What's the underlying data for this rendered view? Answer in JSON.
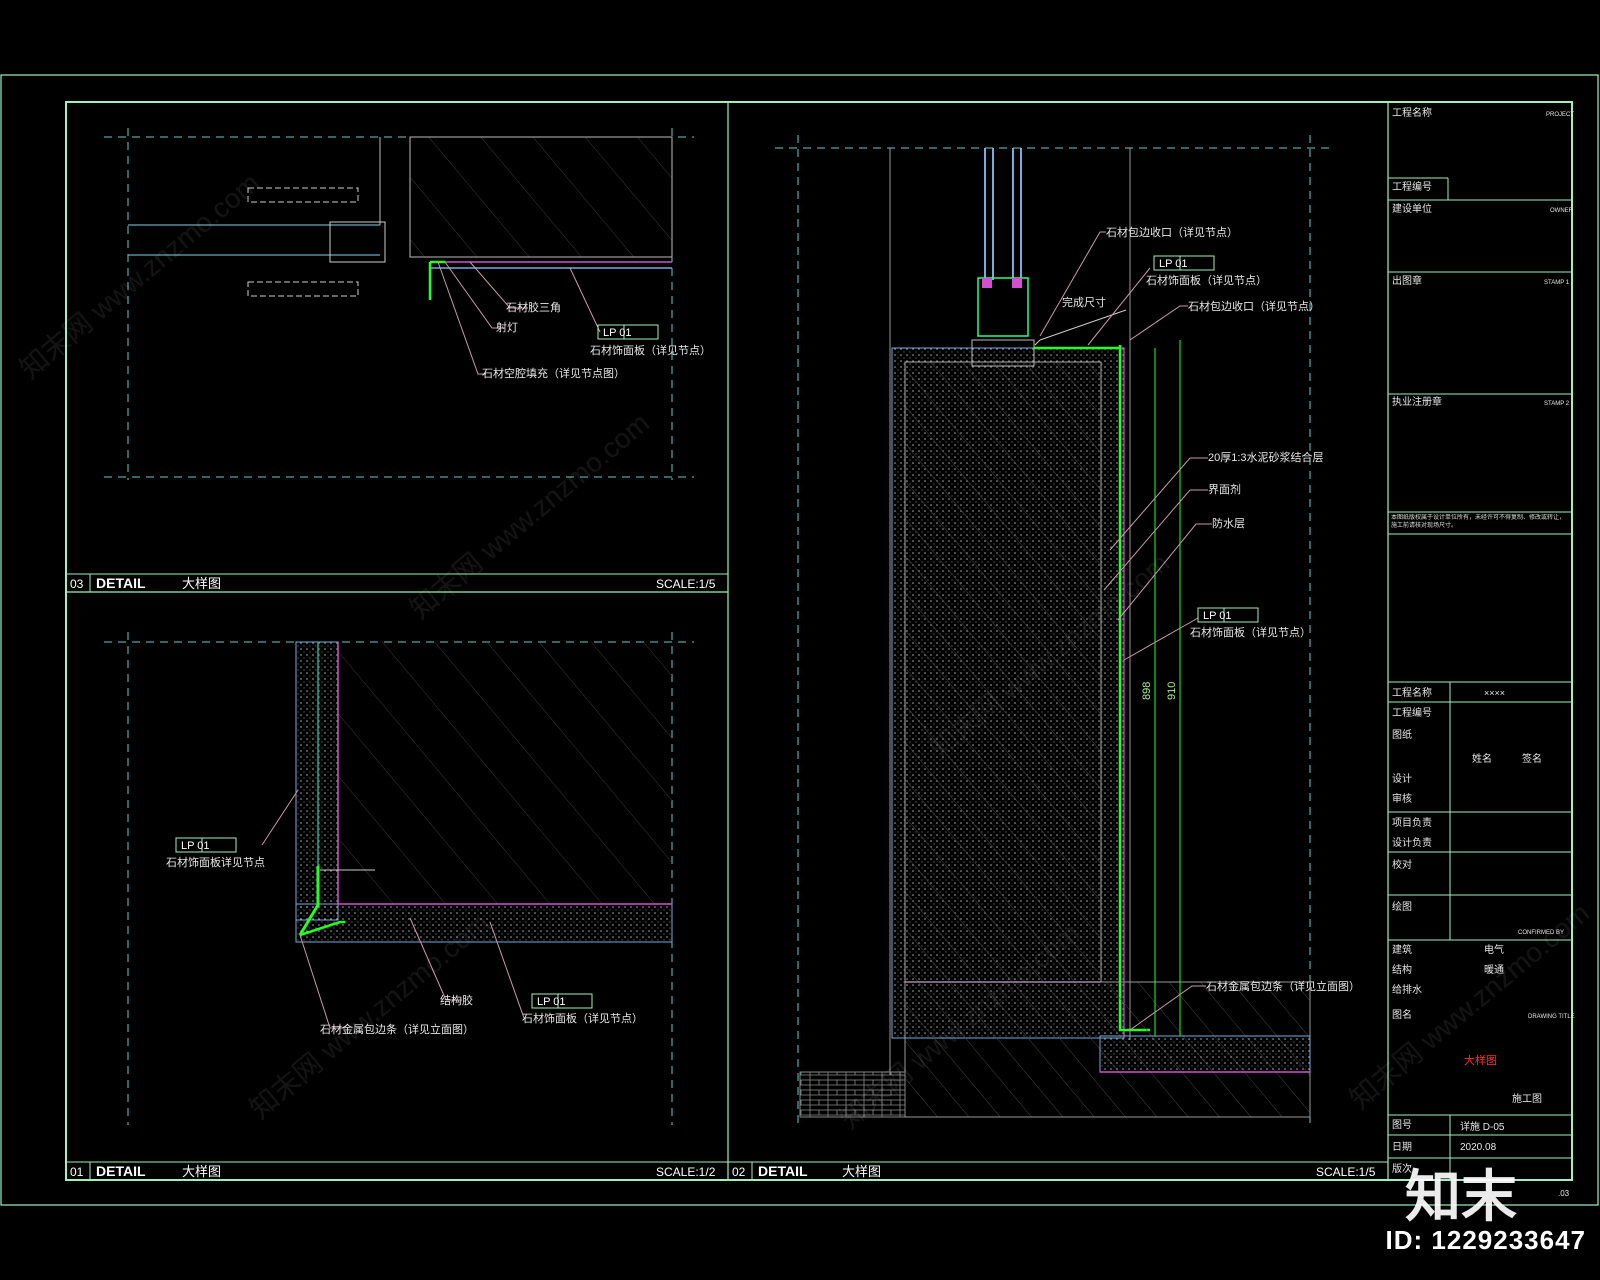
{
  "panels": {
    "p03": {
      "num": "03",
      "title": "DETAIL",
      "subtitle": "大样图",
      "scale": "SCALE:1/5"
    },
    "p01": {
      "num": "01",
      "title": "DETAIL",
      "subtitle": "大样图",
      "scale": "SCALE:1/2"
    },
    "p02": {
      "num": "02",
      "title": "DETAIL",
      "subtitle": "大样图",
      "scale": "SCALE:1/5"
    }
  },
  "notes": {
    "p03": [
      "石材胶三角",
      "射灯",
      "LP 01",
      "石材饰面板（详见节点）",
      "石材空腔填充（详见节点图）"
    ],
    "p01": [
      "LP 01",
      "石材饰面板详见节点",
      "结构胶",
      "LP 01",
      "石材饰面板（详见节点）",
      "石材金属包边条（详见立面图）"
    ],
    "p02": [
      "石材包边收口（详见节点）",
      "LP 01",
      "石材饰面板（详见节点）",
      "完成尺寸",
      "石材包边收口（详见节点）",
      "20厚1:3水泥砂浆结合层",
      "界面剂",
      "防水层",
      "LP 01",
      "石材饰面板（详见节点）",
      "石材金属包边条（详见立面图）"
    ],
    "dims": [
      "898",
      "910"
    ]
  },
  "titleblock": {
    "rows": [
      {
        "cn": "工程名称",
        "en": "PROJECT"
      },
      {
        "cn": "工程编号",
        "en": ""
      },
      {
        "cn": "建设单位",
        "en": "OWNER"
      },
      {
        "cn": "出图章",
        "en": "STAMP 1"
      },
      {
        "cn": "执业注册章",
        "en": "STAMP 2"
      }
    ],
    "note": "本图纸版权属于设计单位所有，未经许可不得复制、修改或转让，施工前请核对现场尺寸。",
    "project_label": "工程名称",
    "project_value": "××××",
    "signs": [
      "工程编号",
      "图纸",
      "设计",
      "审核",
      "项目负责",
      "设计负责",
      "校对",
      "绘图"
    ],
    "sign_cols": [
      "姓名",
      "签名"
    ],
    "confirmed": "CONFIRMED BY",
    "disciplines": [
      "建筑",
      "电气",
      "结构",
      "暖通",
      "给排水"
    ],
    "drawing_title_label": "图名",
    "drawing_title_en": "DRAWING TITLE",
    "drawing_title": "大样图",
    "stage": "施工图",
    "drawing_no_label": "图号",
    "drawing_no": "详施 D-05",
    "date_label": "日期",
    "date": "2020.08",
    "version_label": "版次",
    "page": ".03"
  },
  "watermarks": [
    "知末网 www.znzmo.com"
  ],
  "brand": "知末",
  "id_badge": "ID: 1229233647"
}
